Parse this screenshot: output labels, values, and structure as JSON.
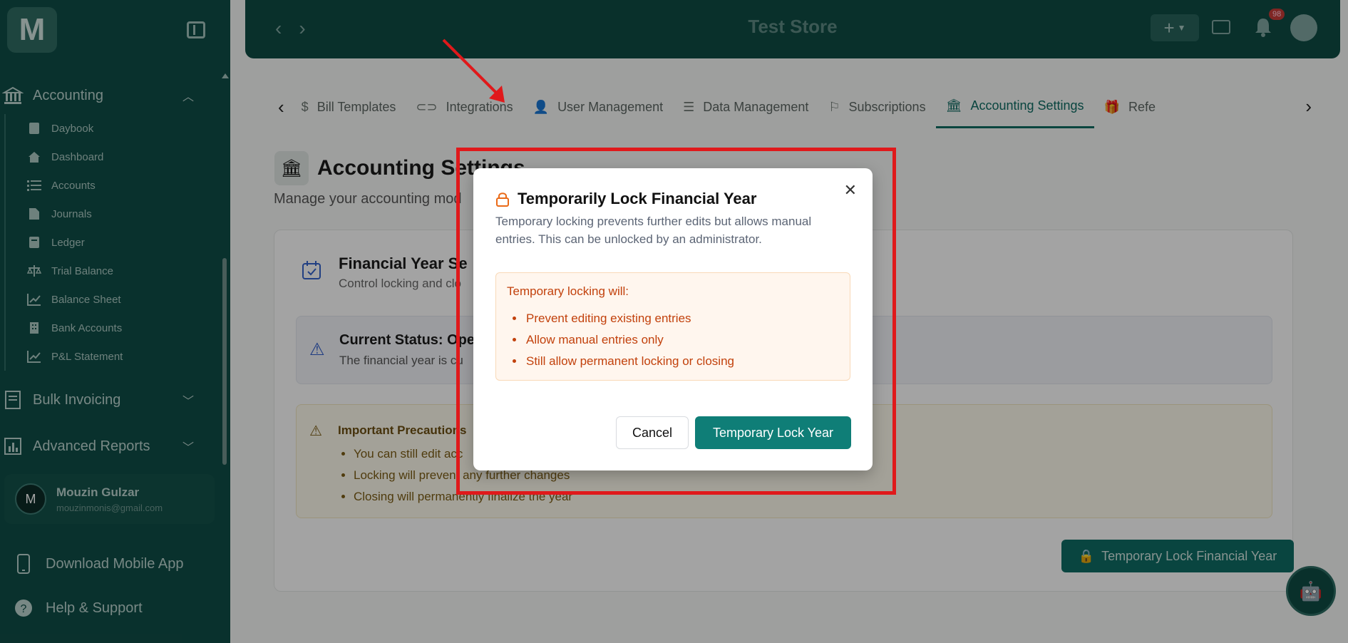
{
  "sidebar": {
    "logo": "M",
    "accounting_section": "Accounting",
    "items": [
      {
        "label": "Daybook",
        "icon": "book-icon"
      },
      {
        "label": "Dashboard",
        "icon": "home-icon"
      },
      {
        "label": "Accounts",
        "icon": "list-icon"
      },
      {
        "label": "Journals",
        "icon": "file-icon"
      },
      {
        "label": "Ledger",
        "icon": "ledger-icon"
      },
      {
        "label": "Trial Balance",
        "icon": "scale-icon"
      },
      {
        "label": "Balance Sheet",
        "icon": "chart-line-icon"
      },
      {
        "label": "Bank Accounts",
        "icon": "building-icon"
      },
      {
        "label": "P&L Statement",
        "icon": "chart-line-icon"
      }
    ],
    "bulk_invoicing": "Bulk Invoicing",
    "advanced_reports": "Advanced Reports",
    "user": {
      "initial": "M",
      "name": "Mouzin Gulzar",
      "email": "mouzinmonis@gmail.com"
    },
    "download_app": "Download Mobile App",
    "help": "Help & Support"
  },
  "header": {
    "store_name": "Test Store",
    "plus_label": "+",
    "notification_count": "98"
  },
  "tabs": [
    {
      "label": "Bill Templates"
    },
    {
      "label": "Integrations"
    },
    {
      "label": "User Management"
    },
    {
      "label": "Data Management"
    },
    {
      "label": "Subscriptions"
    },
    {
      "label": "Accounting Settings"
    },
    {
      "label": "Refe"
    }
  ],
  "page": {
    "title": "Accounting Settings",
    "subtitle": "Manage your accounting mod",
    "fy_title": "Financial Year Se",
    "fy_subtitle": "Control locking and clo",
    "status_title": "Current Status: Ope",
    "status_text": "The financial year is cu",
    "precautions_title": "Important Precautions",
    "precautions": [
      "You can still edit acc",
      "Locking will prevent any further changes",
      "Closing will permanently finalize the year"
    ],
    "lock_button": "Temporary Lock Financial Year"
  },
  "modal": {
    "title": "Temporarily Lock Financial Year",
    "description": "Temporary locking prevents further edits but allows manual entries. This can be unlocked by an administrator.",
    "info_title": "Temporary locking will:",
    "info_items": [
      "Prevent editing existing entries",
      "Allow manual entries only",
      "Still allow permanent locking or closing"
    ],
    "cancel_label": "Cancel",
    "confirm_label": "Temporary Lock Year"
  },
  "colors": {
    "sidebar_bg": "#0f4c45",
    "accent": "#0f7e77",
    "annotation_red": "#e0191b",
    "warning_orange": "#c2410c"
  }
}
